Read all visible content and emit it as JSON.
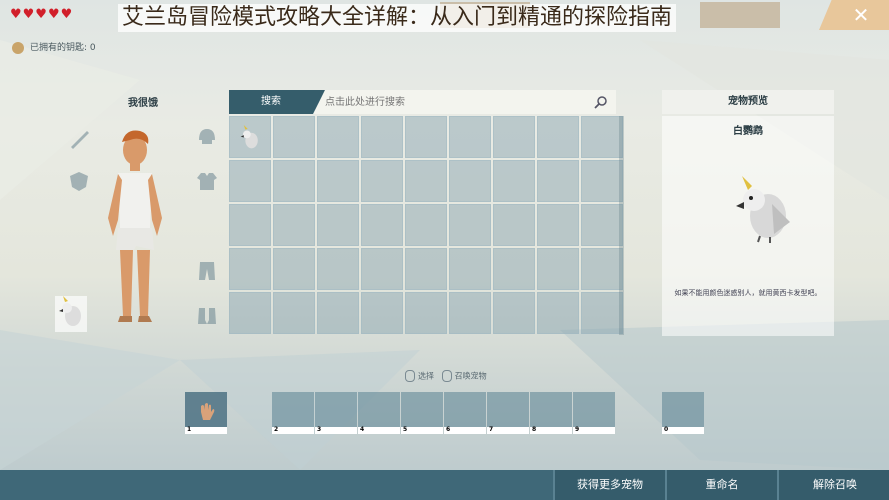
{
  "overlay_title": "艾兰岛冒险模式攻略大全详解：从入门到精通的探险指南",
  "hud": {
    "hearts": "♥♥♥♥♥",
    "close_symbol": "✕",
    "keys_label": "已拥有的钥匙: 0"
  },
  "character": {
    "title": "我很饿"
  },
  "search": {
    "tab_label": "搜索",
    "placeholder": "点击此处进行搜索"
  },
  "preview": {
    "header": "宠物预览",
    "pet_name": "白鹦鹉",
    "description": "如果不能用颜色迷惑别人，就用黄西卡发型吧。"
  },
  "hints": {
    "select": "选择",
    "summon": "召唤宠物"
  },
  "hotbar": {
    "slots": [
      "1",
      "2",
      "3",
      "4",
      "5",
      "6",
      "7",
      "8",
      "9"
    ],
    "extra_slot": "0"
  },
  "buttons": {
    "get_more": "获得更多宠物",
    "rename": "重命名",
    "dismiss": "解除召唤"
  },
  "colors": {
    "accent": "#355c6b",
    "heart": "#d11f2a",
    "close": "#e8c79b"
  }
}
